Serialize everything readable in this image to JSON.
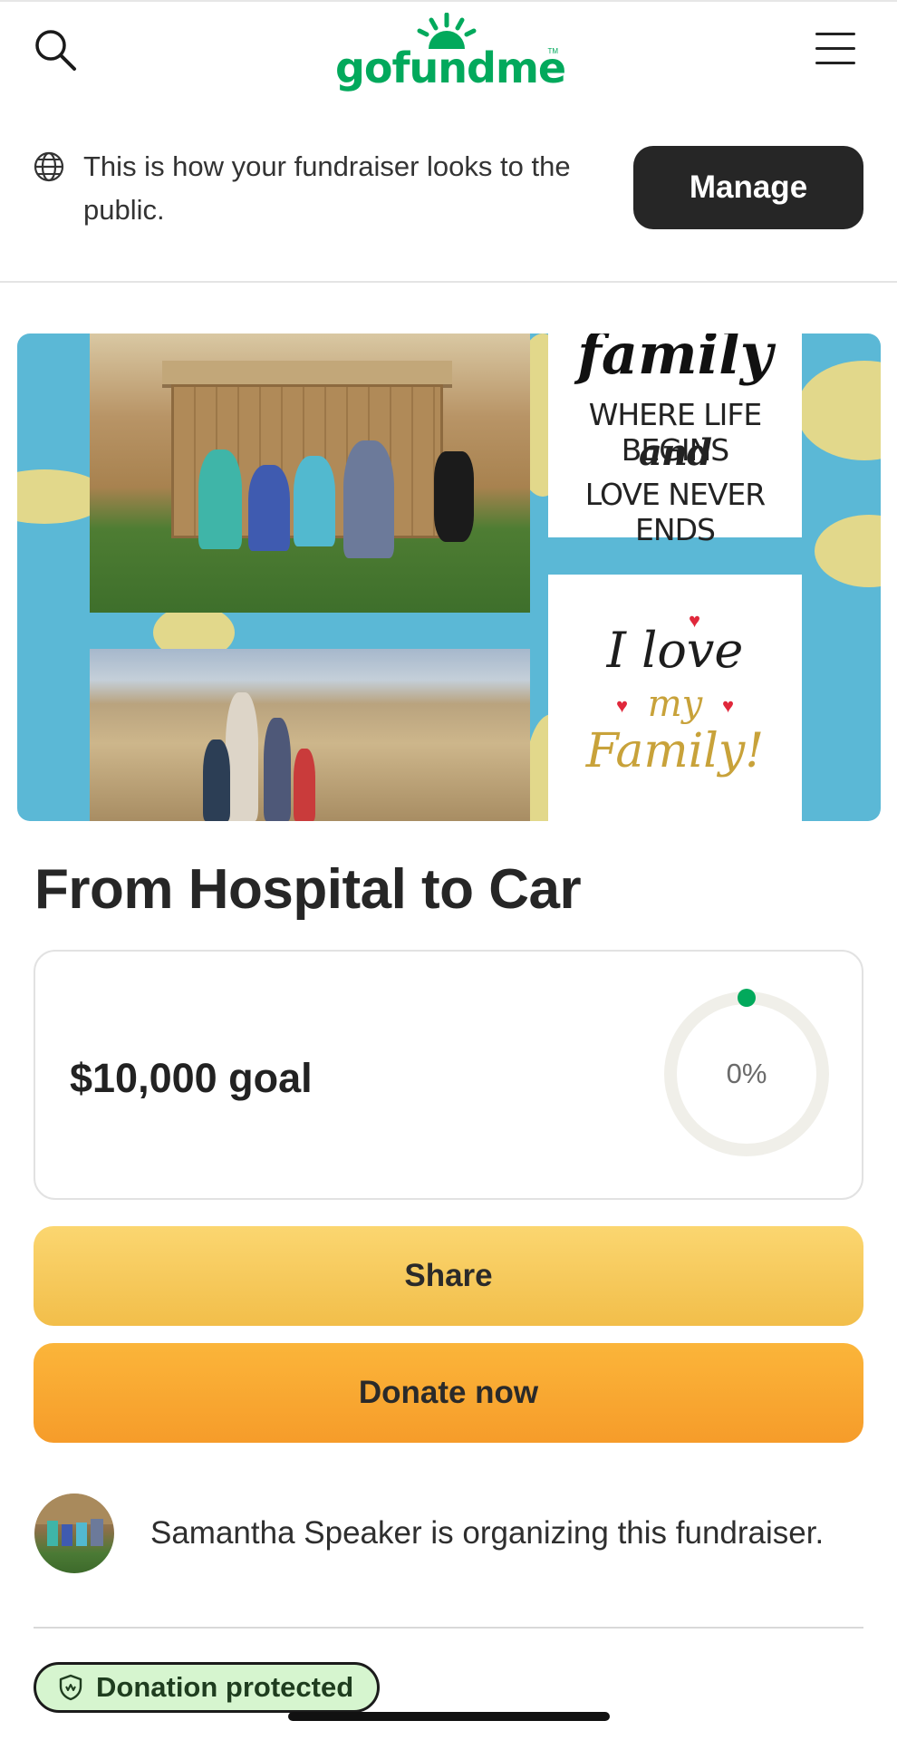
{
  "header": {
    "logo_text": "gofundme",
    "logo_tm": "TM",
    "search_icon": "search-icon",
    "menu_icon": "hamburger-menu-icon"
  },
  "notice": {
    "icon": "globe-icon",
    "text": "This is how your fundraiser looks to the public.",
    "manage_label": "Manage"
  },
  "hero": {
    "card1_script": "family",
    "card1_line1": "WHERE LIFE BEGINS",
    "card1_line2": "and",
    "card1_line3": "LOVE NEVER ENDS",
    "card2_line1": "I love",
    "card2_line2": "my",
    "card2_line3": "Family!"
  },
  "fundraiser": {
    "title": "From Hospital to Car",
    "goal_text": "$10,000 goal",
    "progress_label": "0%",
    "progress_fraction": 0
  },
  "actions": {
    "share_label": "Share",
    "donate_label": "Donate now"
  },
  "organizer": {
    "text": "Samantha Speaker is organizing this fundraiser."
  },
  "badge": {
    "icon": "shield-icon",
    "label": "Donation protected"
  },
  "colors": {
    "brand_green": "#02a95c",
    "share_yellow": "#f2be4a",
    "donate_orange": "#f69c2a",
    "manage_dark": "#262626"
  }
}
